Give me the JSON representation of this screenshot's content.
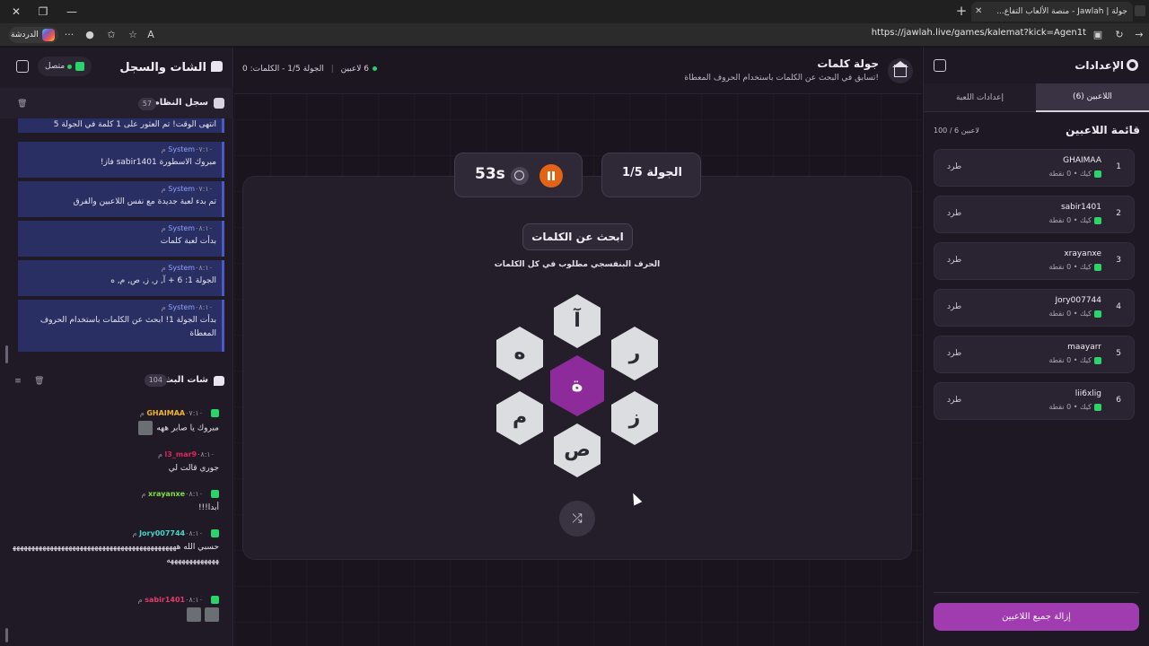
{
  "browser": {
    "tab_title": "جولة | Jawlah - منصة الألعاب التفاع...",
    "url": "https://jawlah.live/games/kalemat?kick=Agen1t",
    "copilot_label": "الدردشة"
  },
  "left_panel": {
    "title": "الشات والسجل",
    "status": "متصل",
    "system_log": {
      "title": "سجل النظام",
      "count": "57",
      "messages": [
        {
          "sender": "",
          "time": "",
          "text": "انتهى الوقت! تم العثور على 1 كلمة في الجولة 5"
        },
        {
          "sender": "System",
          "time": "٠٧:١٠ م",
          "text": "مبروك الاسطورة sabir1401 فاز!"
        },
        {
          "sender": "System",
          "time": "٠٧:١٠ م",
          "text": "تم بدء لعبة جديدة مع نفس اللاعبين والفرق"
        },
        {
          "sender": "System",
          "time": "٠٨:١٠ م",
          "text": "بدأت لعبة كلمات"
        },
        {
          "sender": "System",
          "time": "٠٨:١٠ م",
          "text": "الجولة 1: 6 + آ, ر, ز, ص, م, ه"
        },
        {
          "sender": "System",
          "time": "٠٨:١٠ م",
          "text": "بدأت الجولة 1! ابحث عن الكلمات باستخدام الحروف المعطاة"
        }
      ]
    },
    "live_chat": {
      "title": "شات البث",
      "count": "104",
      "messages": [
        {
          "user": "GHAIMAA",
          "color": "#f0b429",
          "time": "٠٧:١٠ م",
          "text": "مبروك يا صابر ههه"
        },
        {
          "user": "l3_mar9",
          "color": "#e0245e",
          "time": "٠٨:١٠ م",
          "text": "جوري قالت لي"
        },
        {
          "user": "xrayanxe",
          "color": "#7ee23b",
          "time": "٠٨:١٠ م",
          "text": "أبدا!!!"
        },
        {
          "user": "Jory007744",
          "color": "#45d6c6",
          "time": "٠٨:١٠ م",
          "text": "حسبي الله ههههههههههههههههههههههههههههههههههههههههههههههههههههههههههه"
        },
        {
          "user": "sabir1401",
          "color": "#e23b6a",
          "time": "٠٨:١٠ م",
          "text": ""
        }
      ]
    }
  },
  "center": {
    "title": "جولة كلمات",
    "subtitle": "تسابق في البحث عن الكلمات باستخدام الحروف المعطاة!",
    "players_online": "6 لاعبين",
    "round_info": "الجولة 1/5 - الكلمات: 0",
    "timer": "53s",
    "round_label": "الجولة 1/5",
    "find_words": "ابحث عن الكلمات",
    "hint": "الحرف البنفسجي مطلوب في كل الكلمات",
    "letters": {
      "center": "ة",
      "top": "آ",
      "top_right": "ر",
      "bottom_right": "ز",
      "bottom": "ص",
      "bottom_left": "م",
      "top_left": "ه"
    }
  },
  "right_panel": {
    "title": "الإعدادات",
    "tabs": [
      "اللاعبين (6)",
      "إعدادات اللعبة"
    ],
    "players_title": "قائمة اللاعبين",
    "players_count": "100 / 6 لاعبين",
    "kick_label": "طرد",
    "players": [
      {
        "num": "1",
        "name": "GHAIMAA",
        "sub": "كيك • 0 نقطة"
      },
      {
        "num": "2",
        "name": "sabir1401",
        "sub": "كيك • 0 نقطة"
      },
      {
        "num": "3",
        "name": "xrayanxe",
        "sub": "كيك • 0 نقطة"
      },
      {
        "num": "4",
        "name": "Jory007744",
        "sub": "كيك • 0 نقطة"
      },
      {
        "num": "5",
        "name": "maayarr",
        "sub": "كيك • 0 نقطة"
      },
      {
        "num": "6",
        "name": "lii6xlig",
        "sub": "كيك • 0 نقطة"
      }
    ],
    "remove_all": "إزالة جميع اللاعبين"
  }
}
